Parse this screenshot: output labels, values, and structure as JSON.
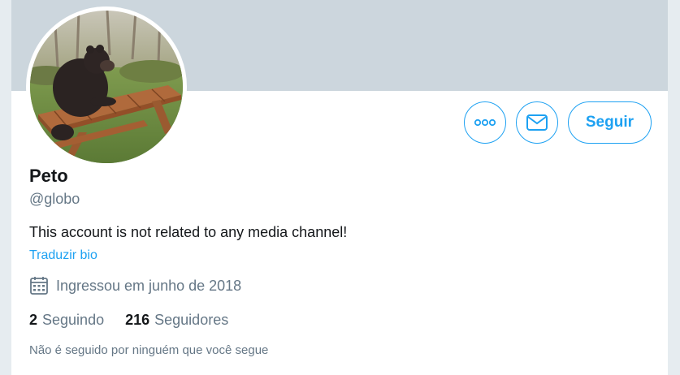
{
  "profile": {
    "name": "Peto",
    "handle": "@globo",
    "bio": "This account is not related to any media channel!",
    "translate_bio": "Traduzir bio",
    "joined": "Ingressou em junho de 2018",
    "following_count": "2",
    "following_label": "Seguindo",
    "followers_count": "216",
    "followers_label": "Seguidores",
    "followed_by_note": "Não é seguido por ninguém que você segue"
  },
  "actions": {
    "more_icon": "more-dots-icon",
    "message_icon": "envelope-icon",
    "follow_label": "Seguir"
  },
  "colors": {
    "accent": "#1da1f2",
    "banner": "#ccd6dd",
    "secondary_text": "#657786",
    "primary_text": "#14171a"
  }
}
